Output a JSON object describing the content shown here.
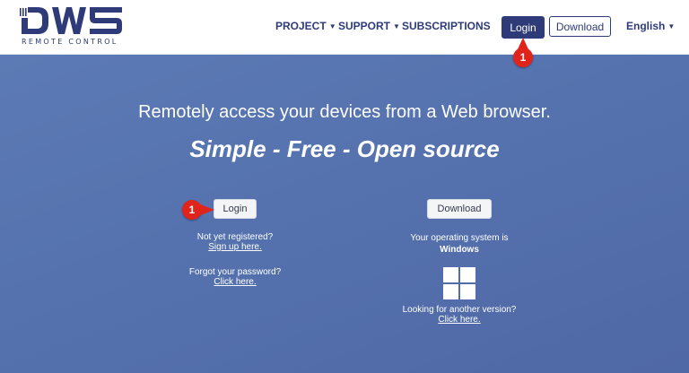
{
  "brand": {
    "logo_text": "DWS",
    "subtitle": "REMOTE CONTROL",
    "color": "#2e3b78"
  },
  "nav": {
    "project": "PROJECT",
    "support": "SUPPORT",
    "subscriptions": "SUBSCRIPTIONS",
    "login": "Login",
    "download": "Download",
    "language": "English"
  },
  "hero": {
    "title": "Remotely access your devices from a Web browser.",
    "tagline": "Simple - Free - Open source"
  },
  "login_section": {
    "button": "Login",
    "not_registered": "Not yet registered?",
    "signup_link": "Sign up here.",
    "forgot": "Forgot your password?",
    "click_here": "Click here."
  },
  "download_section": {
    "button": "Download",
    "os_label": "Your operating system is",
    "os_name": "Windows",
    "another_version": "Looking for another version?",
    "click_here": "Click here."
  },
  "annotations": {
    "marker_top": "1",
    "marker_main": "1"
  },
  "icons": {
    "caret": "caret-down-icon",
    "os": "windows-logo-icon"
  },
  "colors": {
    "accent": "#2e3b78",
    "marker": "#e0241b",
    "hero_bg": "#5572ae"
  }
}
